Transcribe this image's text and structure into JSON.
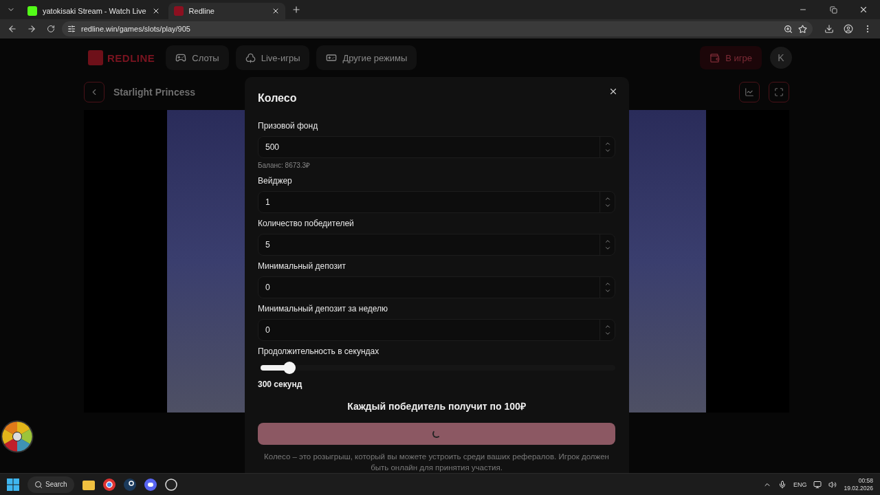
{
  "browser": {
    "tabs": [
      {
        "title": "yatokisaki Stream - Watch Live",
        "kind": "k",
        "selected": false
      },
      {
        "title": "Redline",
        "kind": "r",
        "selected": true
      }
    ],
    "url": "redline.win/games/slots/play/905"
  },
  "header": {
    "logo": "REDLINE",
    "nav": [
      {
        "label": "Слоты",
        "kind": "gamepad"
      },
      {
        "label": "Live-игры",
        "kind": "club"
      },
      {
        "label": "Другие режимы",
        "kind": "controller"
      }
    ],
    "in_game": "В игре",
    "avatar": "K"
  },
  "game": {
    "title": "Starlight Princess"
  },
  "modal": {
    "title": "Колесо",
    "fields": [
      {
        "label": "Призовой фонд",
        "value": "500",
        "hint": "Баланс: 8673.3₽"
      },
      {
        "label": "Вейджер",
        "value": "1"
      },
      {
        "label": "Количество победителей",
        "value": "5"
      },
      {
        "label": "Минимальный депозит",
        "value": "0"
      },
      {
        "label": "Минимальный депозит за неделю",
        "value": "0"
      }
    ],
    "slider": {
      "label": "Продолжительность в секундах",
      "level": 0.08,
      "reading": "300 секунд"
    },
    "summary": "Каждый победитель получит по 100₽",
    "submit": {
      "loading": true,
      "disabled": true
    },
    "description": "Колесо – это розыгрыш, который вы можете устроить среди ваших рефералов. Игрок должен быть онлайн для принятия участия."
  },
  "taskbar": {
    "search": "Search",
    "language": "ENG",
    "time": "00:58",
    "date": "19.02.2026"
  }
}
